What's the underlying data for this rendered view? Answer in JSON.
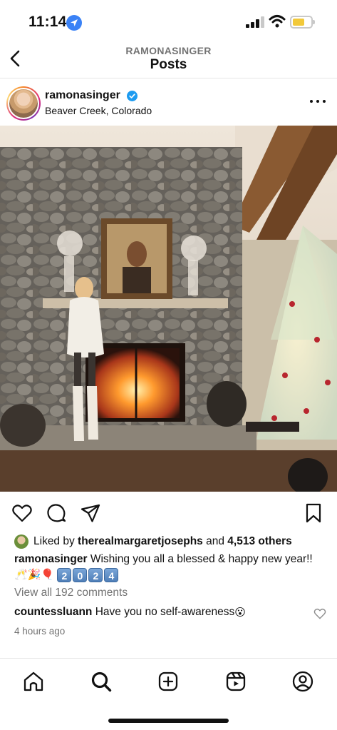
{
  "status_bar": {
    "time": "11:14"
  },
  "header": {
    "subtitle": "RAMONASINGER",
    "title": "Posts"
  },
  "post": {
    "username": "ramonasinger",
    "verified": true,
    "location": "Beaver Creek, Colorado",
    "image_description": "Woman in white dress and cowboy boots standing by stone fireplace with lit fire, portrait painting above mantel, decorated Christmas tree at right"
  },
  "likes": {
    "prefix": "Liked by ",
    "user": "therealmargaretjosephs",
    "middle": " and ",
    "count": "4,513 others"
  },
  "caption": {
    "username": "ramonasinger",
    "text": "Wishing you all a blessed & happy new year!!",
    "emojis": "🥂🎉🎈",
    "keycaps": [
      "2",
      "0",
      "2",
      "4"
    ]
  },
  "comments": {
    "view_all": "View all 192 comments",
    "items": [
      {
        "username": "countessluann",
        "text": "Have you no self-awareness",
        "emoji": "😮"
      }
    ]
  },
  "timestamp": "4 hours ago",
  "icons": {
    "back": "chevron-left-icon",
    "more": "more-horizontal-icon",
    "like": "heart-icon",
    "comment": "comment-icon",
    "share": "paper-plane-icon",
    "save": "bookmark-icon",
    "nav": [
      "home-icon",
      "search-icon",
      "create-icon",
      "reels-icon",
      "profile-icon"
    ]
  },
  "colors": {
    "accent": "#3a82f6",
    "verified": "#1d9bf0",
    "muted": "#737373"
  }
}
